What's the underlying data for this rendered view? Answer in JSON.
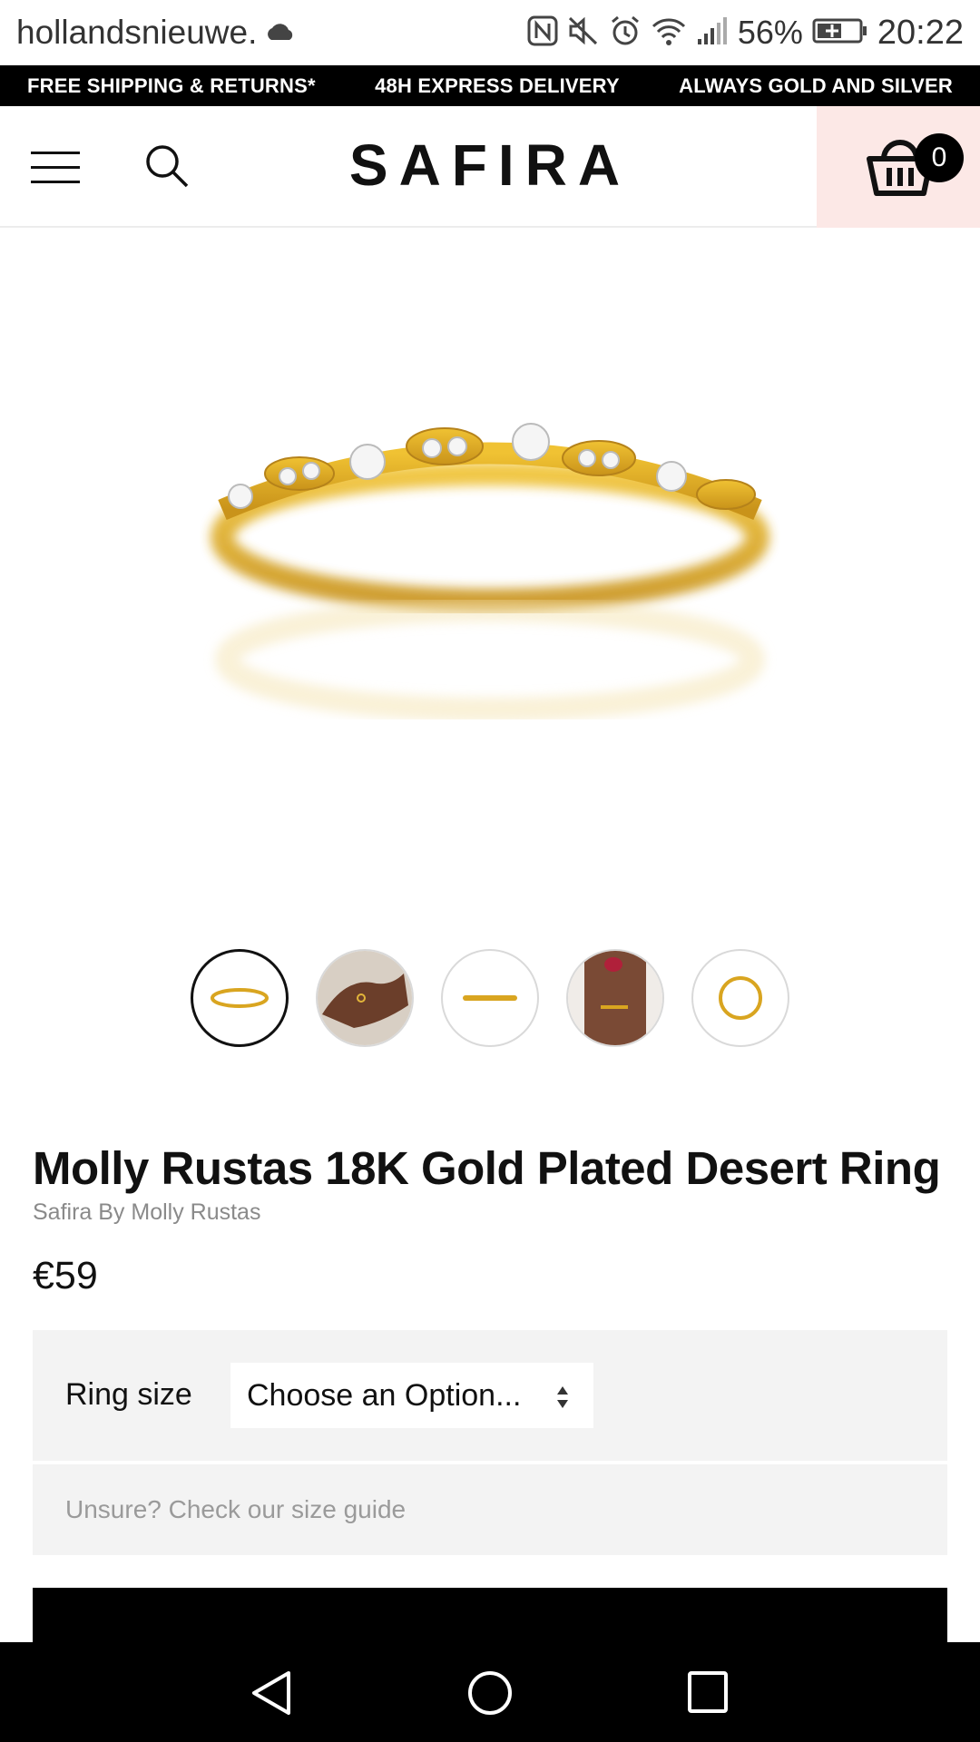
{
  "status_bar": {
    "url": "hollandsnieuwe.",
    "battery_percent": "56%",
    "time": "20:22",
    "icons": [
      "cloud-icon",
      "nfc-icon",
      "mute-icon",
      "alarm-icon",
      "wifi-icon",
      "signal-icon",
      "battery-charging-icon"
    ]
  },
  "promo": {
    "items": [
      "FREE SHIPPING & RETURNS*",
      "48H EXPRESS DELIVERY",
      "ALWAYS GOLD AND SILVER"
    ]
  },
  "header": {
    "logo": "SAFIRA",
    "cart_count": "0",
    "colors": {
      "cart_bg": "#fce8e6"
    }
  },
  "gallery": {
    "thumbnails": [
      "ring-front",
      "hand-wearing",
      "ring-side",
      "hand-nails",
      "ring-top"
    ],
    "active_index": 0
  },
  "product": {
    "title": "Molly Rustas 18K Gold Plated Desert Ring",
    "brand": "Safira By Molly Rustas",
    "price": "€59"
  },
  "options": {
    "ring_size_label": "Ring size",
    "ring_size_value": "Choose an Option...",
    "size_guide": "Unsure? Check our size guide"
  },
  "colors": {
    "gold": "#d9a520",
    "panel": "#f3f3f3"
  }
}
